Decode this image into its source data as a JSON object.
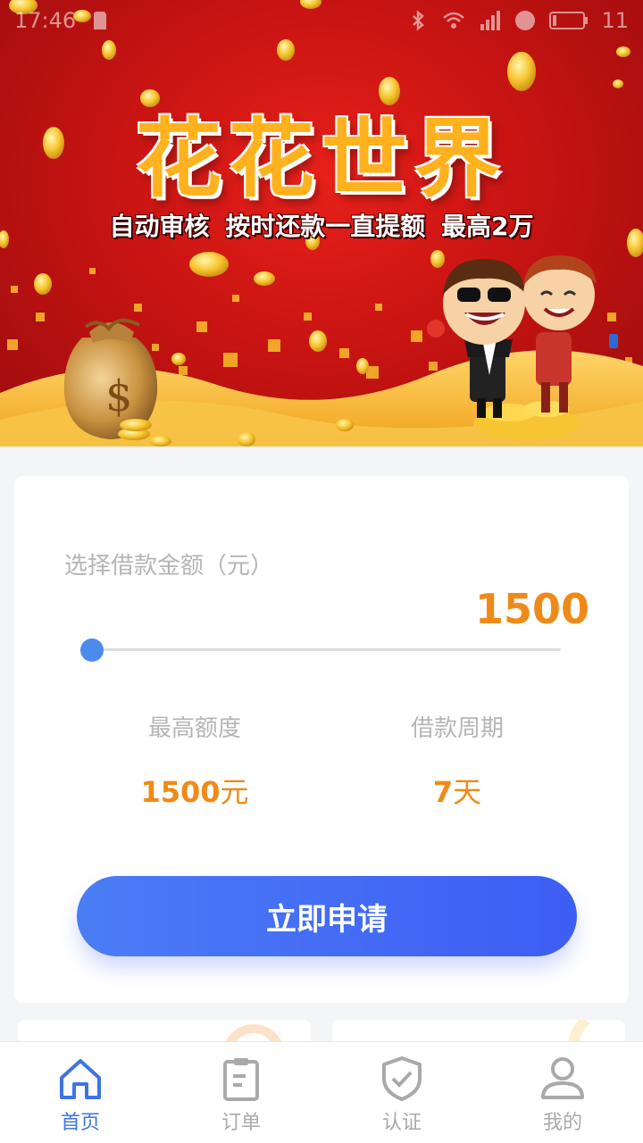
{
  "status_bar": {
    "time": "17:46",
    "battery": "11"
  },
  "banner": {
    "title": "花花世界",
    "subtitle": "自动审核  按时还款一直提额  最高2万"
  },
  "loan": {
    "amount_label": "选择借款金额（元）",
    "amount_value": "1500",
    "slider_fraction": 0,
    "max_limit_label": "最高额度",
    "max_limit_value": "1500",
    "max_limit_unit": "元",
    "period_label": "借款周期",
    "period_value": "7",
    "period_unit": "天",
    "apply_label": "立即申请"
  },
  "tabs": [
    {
      "label": "首页",
      "icon": "home-icon",
      "active": true
    },
    {
      "label": "订单",
      "icon": "clipboard-icon",
      "active": false
    },
    {
      "label": "认证",
      "icon": "shield-check-icon",
      "active": false
    },
    {
      "label": "我的",
      "icon": "user-icon",
      "active": false
    }
  ],
  "colors": {
    "accent_blue": "#3f73e4",
    "amount_orange": "#ef8a18",
    "banner_red": "#c81412",
    "tab_inactive": "#a9a9a9"
  }
}
